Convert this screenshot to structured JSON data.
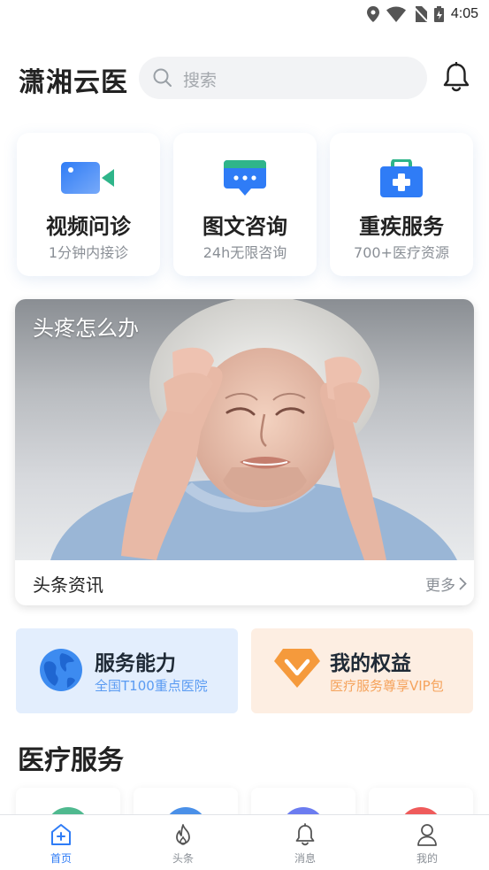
{
  "status_bar": {
    "time": "4:05",
    "icons": [
      "location-icon",
      "wifi-icon",
      "no-sim-icon",
      "battery-icon"
    ]
  },
  "header": {
    "app_title": "潇湘云医",
    "search_placeholder": "搜索",
    "bell_icon": "bell-icon"
  },
  "quick_services": [
    {
      "title": "视频问诊",
      "subtitle": "1分钟内接诊",
      "icon": "video-camera-icon"
    },
    {
      "title": "图文咨询",
      "subtitle": "24h无限咨询",
      "icon": "chat-bubble-icon"
    },
    {
      "title": "重疾服务",
      "subtitle": "700+医疗资源",
      "icon": "medical-kit-icon"
    }
  ],
  "news_card": {
    "image_caption": "头疼怎么办",
    "section_label": "头条资讯",
    "more_label": "更多"
  },
  "benefits": [
    {
      "title": "服务能力",
      "subtitle": "全国T100重点医院",
      "icon": "globe-icon",
      "subtitle_color": "#5a9bf2",
      "bg_color": "#e3eefd"
    },
    {
      "title": "我的权益",
      "subtitle": "医疗服务尊享VIP包",
      "icon": "diamond-icon",
      "subtitle_color": "#f5a35c",
      "bg_color": "#fdeee2"
    }
  ],
  "medical_services": {
    "title": "医疗服务",
    "circle_colors": [
      "#4fb98f",
      "#4a90e8",
      "#6b7cf0",
      "#ef5b5b"
    ]
  },
  "tab_bar": {
    "tabs": [
      {
        "label": "首页",
        "icon": "home-icon",
        "active": true
      },
      {
        "label": "头条",
        "icon": "flame-icon",
        "active": false
      },
      {
        "label": "消息",
        "icon": "bell-icon",
        "active": false
      },
      {
        "label": "我的",
        "icon": "user-icon",
        "active": false
      }
    ]
  },
  "colors": {
    "accent": "#2f7cf6",
    "text_primary": "#222222",
    "text_secondary": "#8a8f96"
  }
}
